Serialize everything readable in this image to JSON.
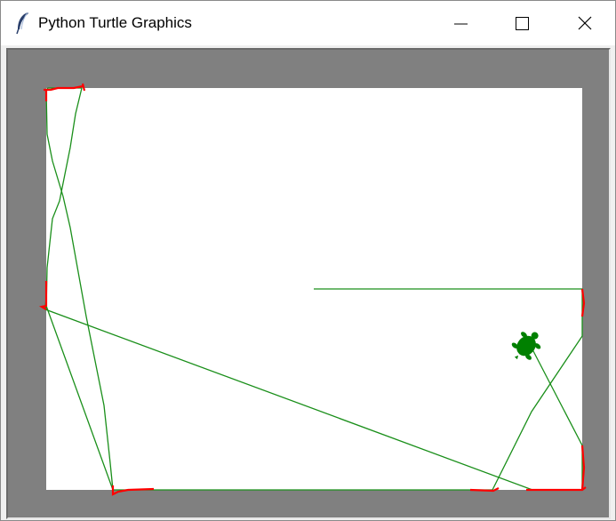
{
  "window": {
    "title": "Python Turtle Graphics",
    "app_icon": "feather-icon",
    "controls": {
      "minimize_icon": "minimize-icon",
      "maximize_icon": "maximize-icon",
      "close_icon": "close-icon"
    }
  },
  "canvas": {
    "background_color": "#808080",
    "drawing_area_color": "#ffffff",
    "path_color": "#1a8f1a",
    "wall_hit_marker_color": "#ff0000",
    "turtle_color": "#008000",
    "turtle_icon": "turtle-icon"
  }
}
